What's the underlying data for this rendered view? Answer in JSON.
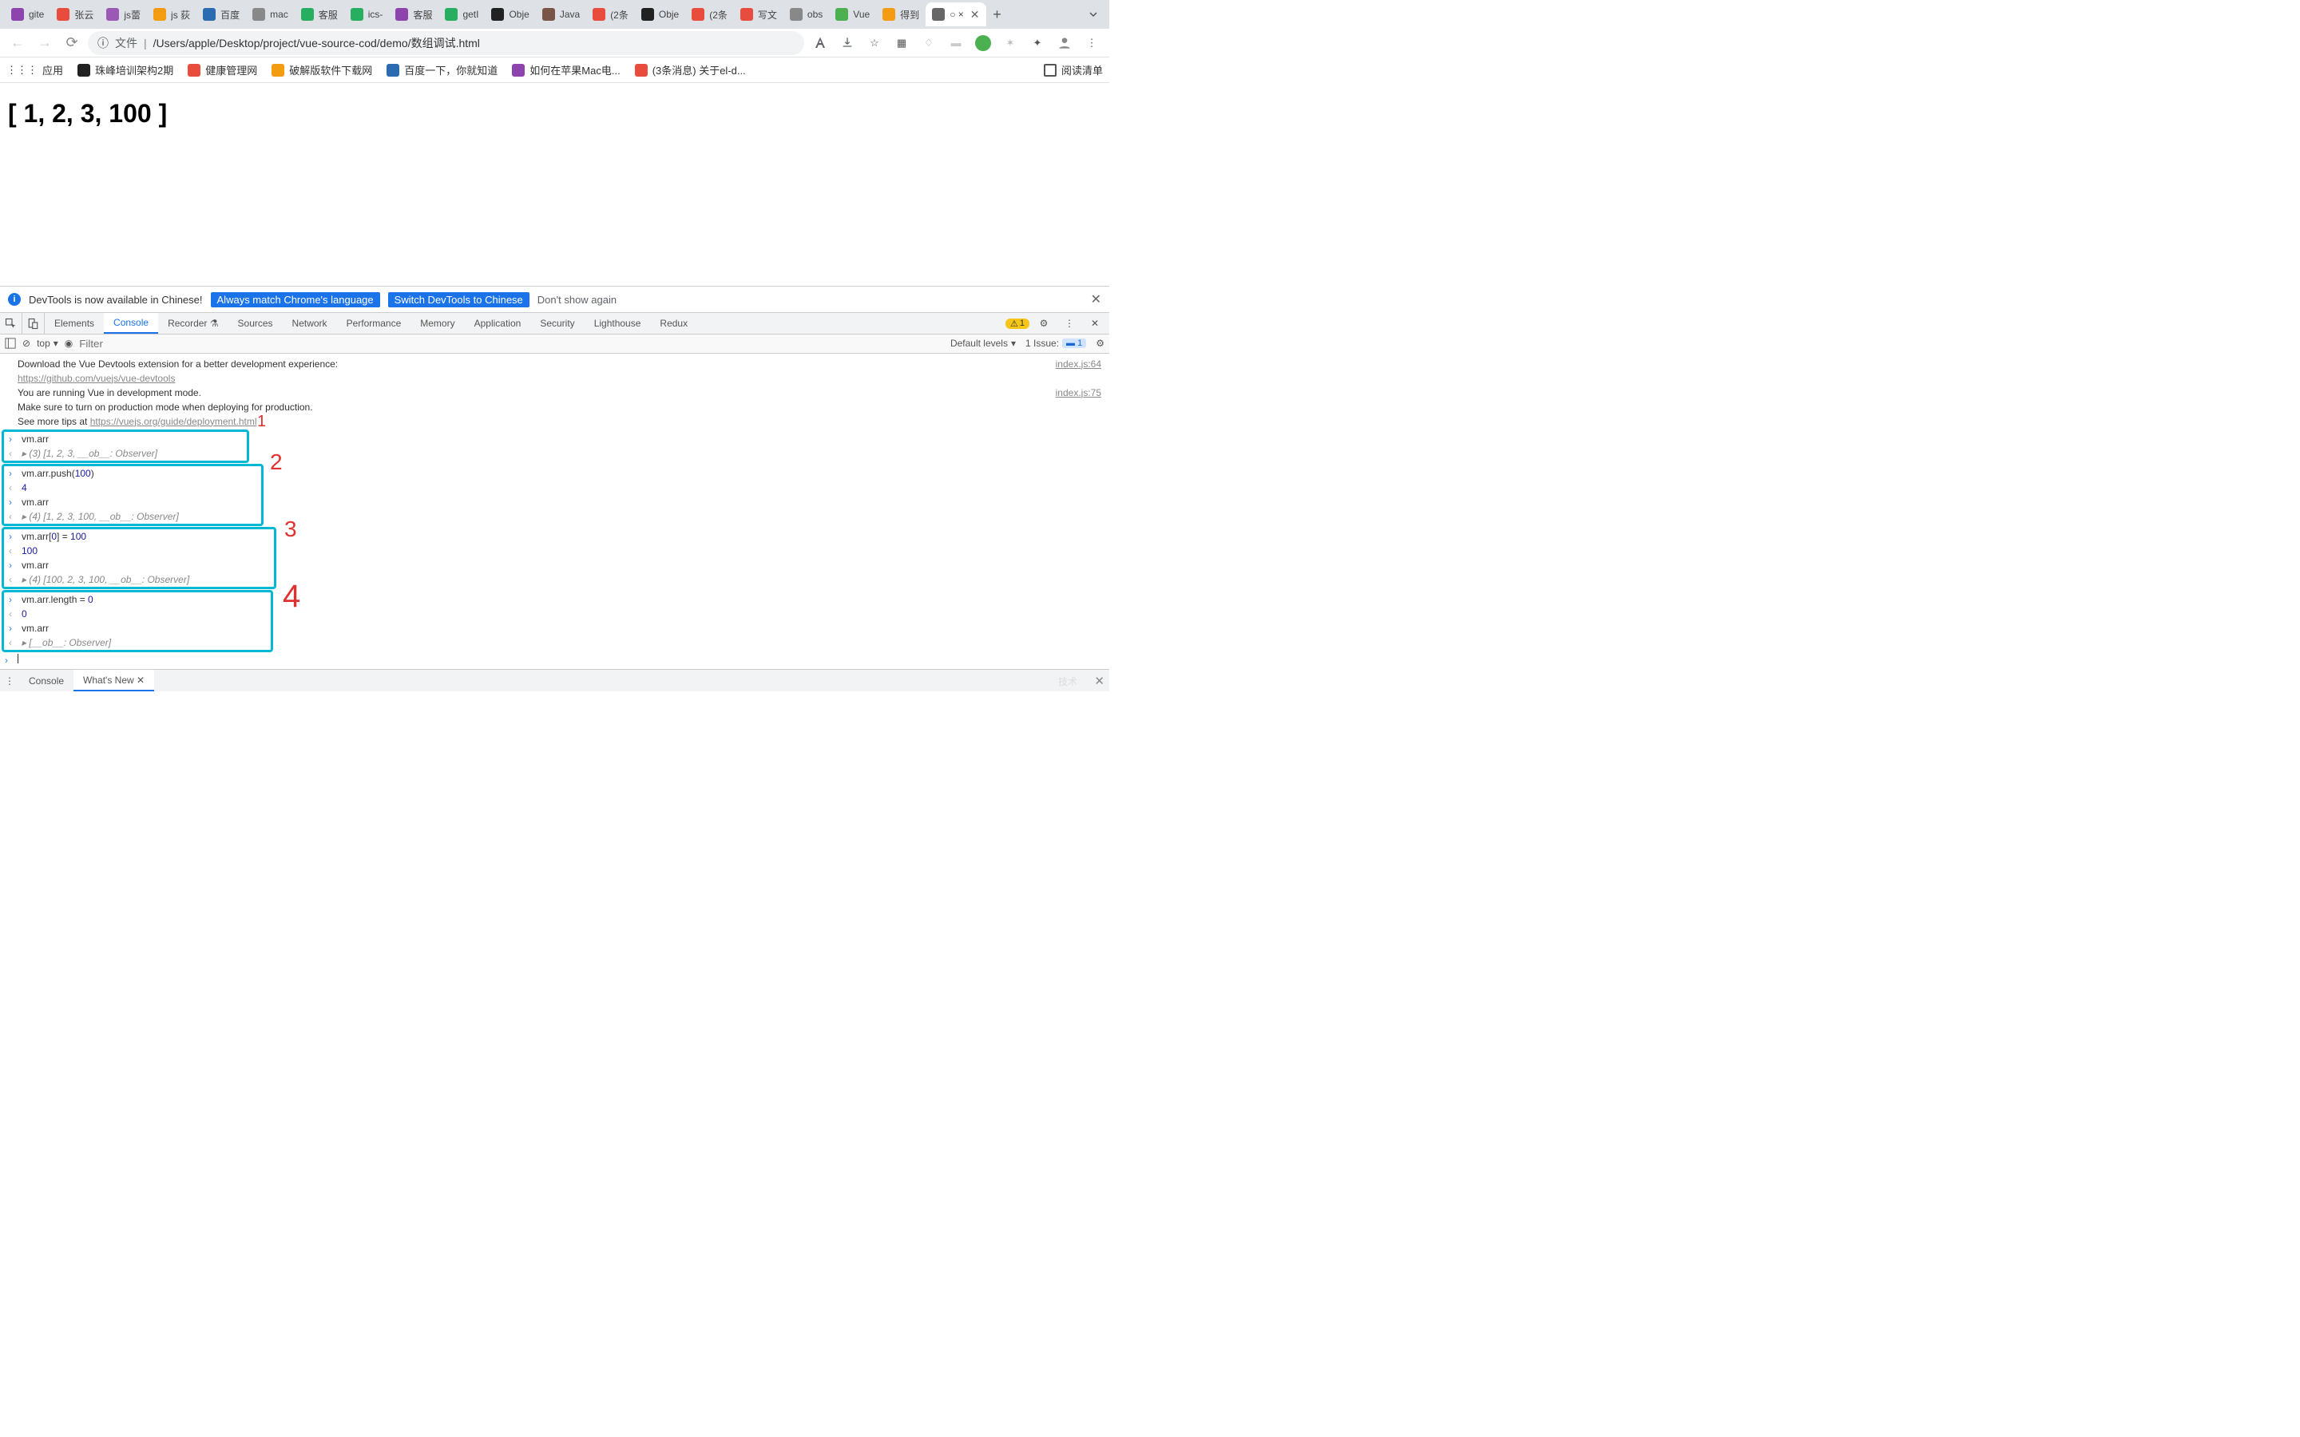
{
  "tabs": [
    {
      "label": "gite",
      "color": "#8e44ad"
    },
    {
      "label": "张云",
      "color": "#e74c3c"
    },
    {
      "label": "js蕾",
      "color": "#9b59b6"
    },
    {
      "label": "js 荻",
      "color": "#f39c12"
    },
    {
      "label": "百度",
      "color": "#2b6cb0"
    },
    {
      "label": "mac",
      "color": "#888"
    },
    {
      "label": "客服",
      "color": "#27ae60"
    },
    {
      "label": "ics-",
      "color": "#27ae60"
    },
    {
      "label": "客服",
      "color": "#8e44ad"
    },
    {
      "label": "getI",
      "color": "#27ae60"
    },
    {
      "label": "Obje",
      "color": "#222"
    },
    {
      "label": "Java",
      "color": "#795548"
    },
    {
      "label": "(2条",
      "color": "#e74c3c"
    },
    {
      "label": "Obje",
      "color": "#222"
    },
    {
      "label": "(2条",
      "color": "#e74c3c"
    },
    {
      "label": "写文",
      "color": "#e74c3c"
    },
    {
      "label": "obs",
      "color": "#888"
    },
    {
      "label": "Vue",
      "color": "#4caf50"
    },
    {
      "label": "得到",
      "color": "#f39c12"
    },
    {
      "label": "○ ×",
      "color": "#666",
      "active": true
    }
  ],
  "url": {
    "prefix": "文件",
    "path": "/Users/apple/Desktop/project/vue-source-cod/demo/数组调试.html"
  },
  "bookmarks_label": "应用",
  "bookmarks": [
    {
      "label": "珠峰培训架构2期",
      "color": "#222"
    },
    {
      "label": "健康管理网",
      "color": "#e74c3c"
    },
    {
      "label": "破解版软件下载网",
      "color": "#f39c12"
    },
    {
      "label": "百度一下，你就知道",
      "color": "#2b6cb0"
    },
    {
      "label": "如何在苹果Mac电...",
      "color": "#8e44ad"
    },
    {
      "label": "(3条消息) 关于el-d...",
      "color": "#e74c3c"
    }
  ],
  "reading_list": "阅读清单",
  "page_text": "[ 1, 2, 3, 100 ]",
  "lang_bar": {
    "msg": "DevTools is now available in Chinese!",
    "btn1": "Always match Chrome's language",
    "btn2": "Switch DevTools to Chinese",
    "dismiss": "Don't show again"
  },
  "devtools_tabs": [
    "Elements",
    "Console",
    "Recorder ⚗",
    "Sources",
    "Network",
    "Performance",
    "Memory",
    "Application",
    "Security",
    "Lighthouse",
    "Redux"
  ],
  "devtools_active": "Console",
  "warn_count": "1",
  "filter": {
    "context": "top",
    "placeholder": "Filter",
    "levels": "Default levels",
    "issues": "1 Issue:",
    "issue_count": "1"
  },
  "console": {
    "msg1": "Download the Vue Devtools extension for a better development experience:",
    "link1": "https://github.com/vuejs/vue-devtools",
    "src1": "index.js:64",
    "msg2a": "You are running Vue in development mode.",
    "msg2b": "Make sure to turn on production mode when deploying for production.",
    "msg2c": "See more tips at ",
    "link2": "https://vuejs.org/guide/deployment.html",
    "src2": "index.js:75",
    "b1_in": "vm.arr",
    "b1_out": "(3) [1, 2, 3, __ob__: Observer]",
    "b2_in1": "vm.arr.push(100)",
    "b2_out1": "4",
    "b2_in2": "vm.arr",
    "b2_out2": "(4) [1, 2, 3, 100, __ob__: Observer]",
    "b3_in1": "vm.arr[0] = 100",
    "b3_out1": "100",
    "b3_in2": "vm.arr",
    "b3_out2": "(4) [100, 2, 3, 100, __ob__: Observer]",
    "b4_in1": "vm.arr.length = 0",
    "b4_out1": "0",
    "b4_in2": "vm.arr",
    "b4_out2": "[__ob__: Observer]",
    "num_100": "100"
  },
  "annotations": [
    "1",
    "2",
    "3",
    "4"
  ],
  "drawer": {
    "tab1": "Console",
    "tab2": "What's New"
  },
  "watermark": "技术"
}
